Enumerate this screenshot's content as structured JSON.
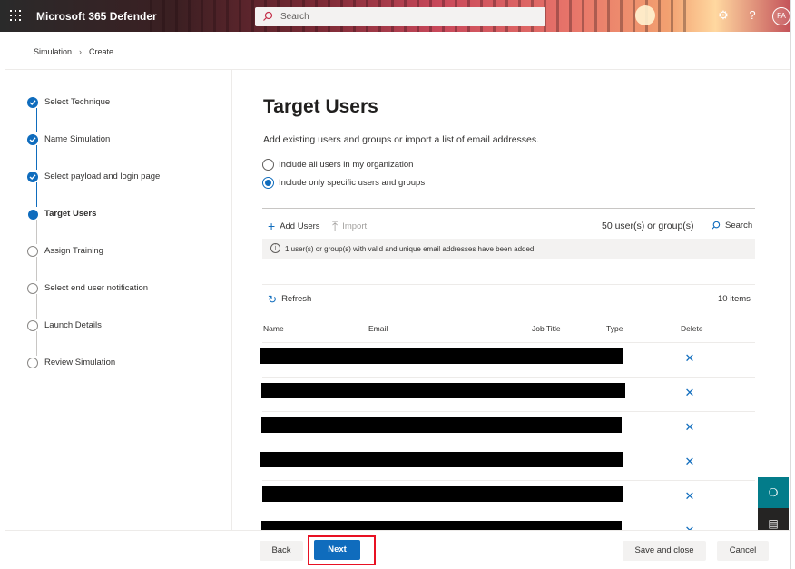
{
  "header": {
    "app_title": "Microsoft 365 Defender",
    "search_placeholder": "Search",
    "avatar_initials": "FA",
    "settings_icon": "gear-icon",
    "help_icon": "question-icon"
  },
  "breadcrumb": {
    "items": [
      "Simulation",
      "Create"
    ]
  },
  "wizard": {
    "steps": [
      {
        "label": "Select Technique",
        "status": "done"
      },
      {
        "label": "Name Simulation",
        "status": "done"
      },
      {
        "label": "Select payload and login page",
        "status": "done"
      },
      {
        "label": "Target Users",
        "status": "current"
      },
      {
        "label": "Assign Training",
        "status": "todo"
      },
      {
        "label": "Select end user notification",
        "status": "todo"
      },
      {
        "label": "Launch Details",
        "status": "todo"
      },
      {
        "label": "Review Simulation",
        "status": "todo"
      }
    ]
  },
  "main": {
    "title": "Target Users",
    "description": "Add existing users and groups or import a list of email addresses.",
    "radio_all": "Include all users in my organization",
    "radio_specific": "Include only specific users and groups",
    "selected_option": "specific",
    "toolbar": {
      "add_users": "Add Users",
      "import": "Import",
      "count": "50 user(s) or group(s)",
      "search": "Search"
    },
    "info_message": "1 user(s) or group(s) with valid and unique email addresses have been added.",
    "refresh": "Refresh",
    "items_count": "10 items",
    "columns": [
      "Name",
      "Email",
      "Job Title",
      "Type",
      "Delete"
    ]
  },
  "footer": {
    "back": "Back",
    "next": "Next",
    "save_close": "Save and close",
    "cancel": "Cancel"
  },
  "colors": {
    "accent": "#0f6cbd",
    "highlight_box": "#e81123",
    "teal_fab": "#037c8a"
  }
}
